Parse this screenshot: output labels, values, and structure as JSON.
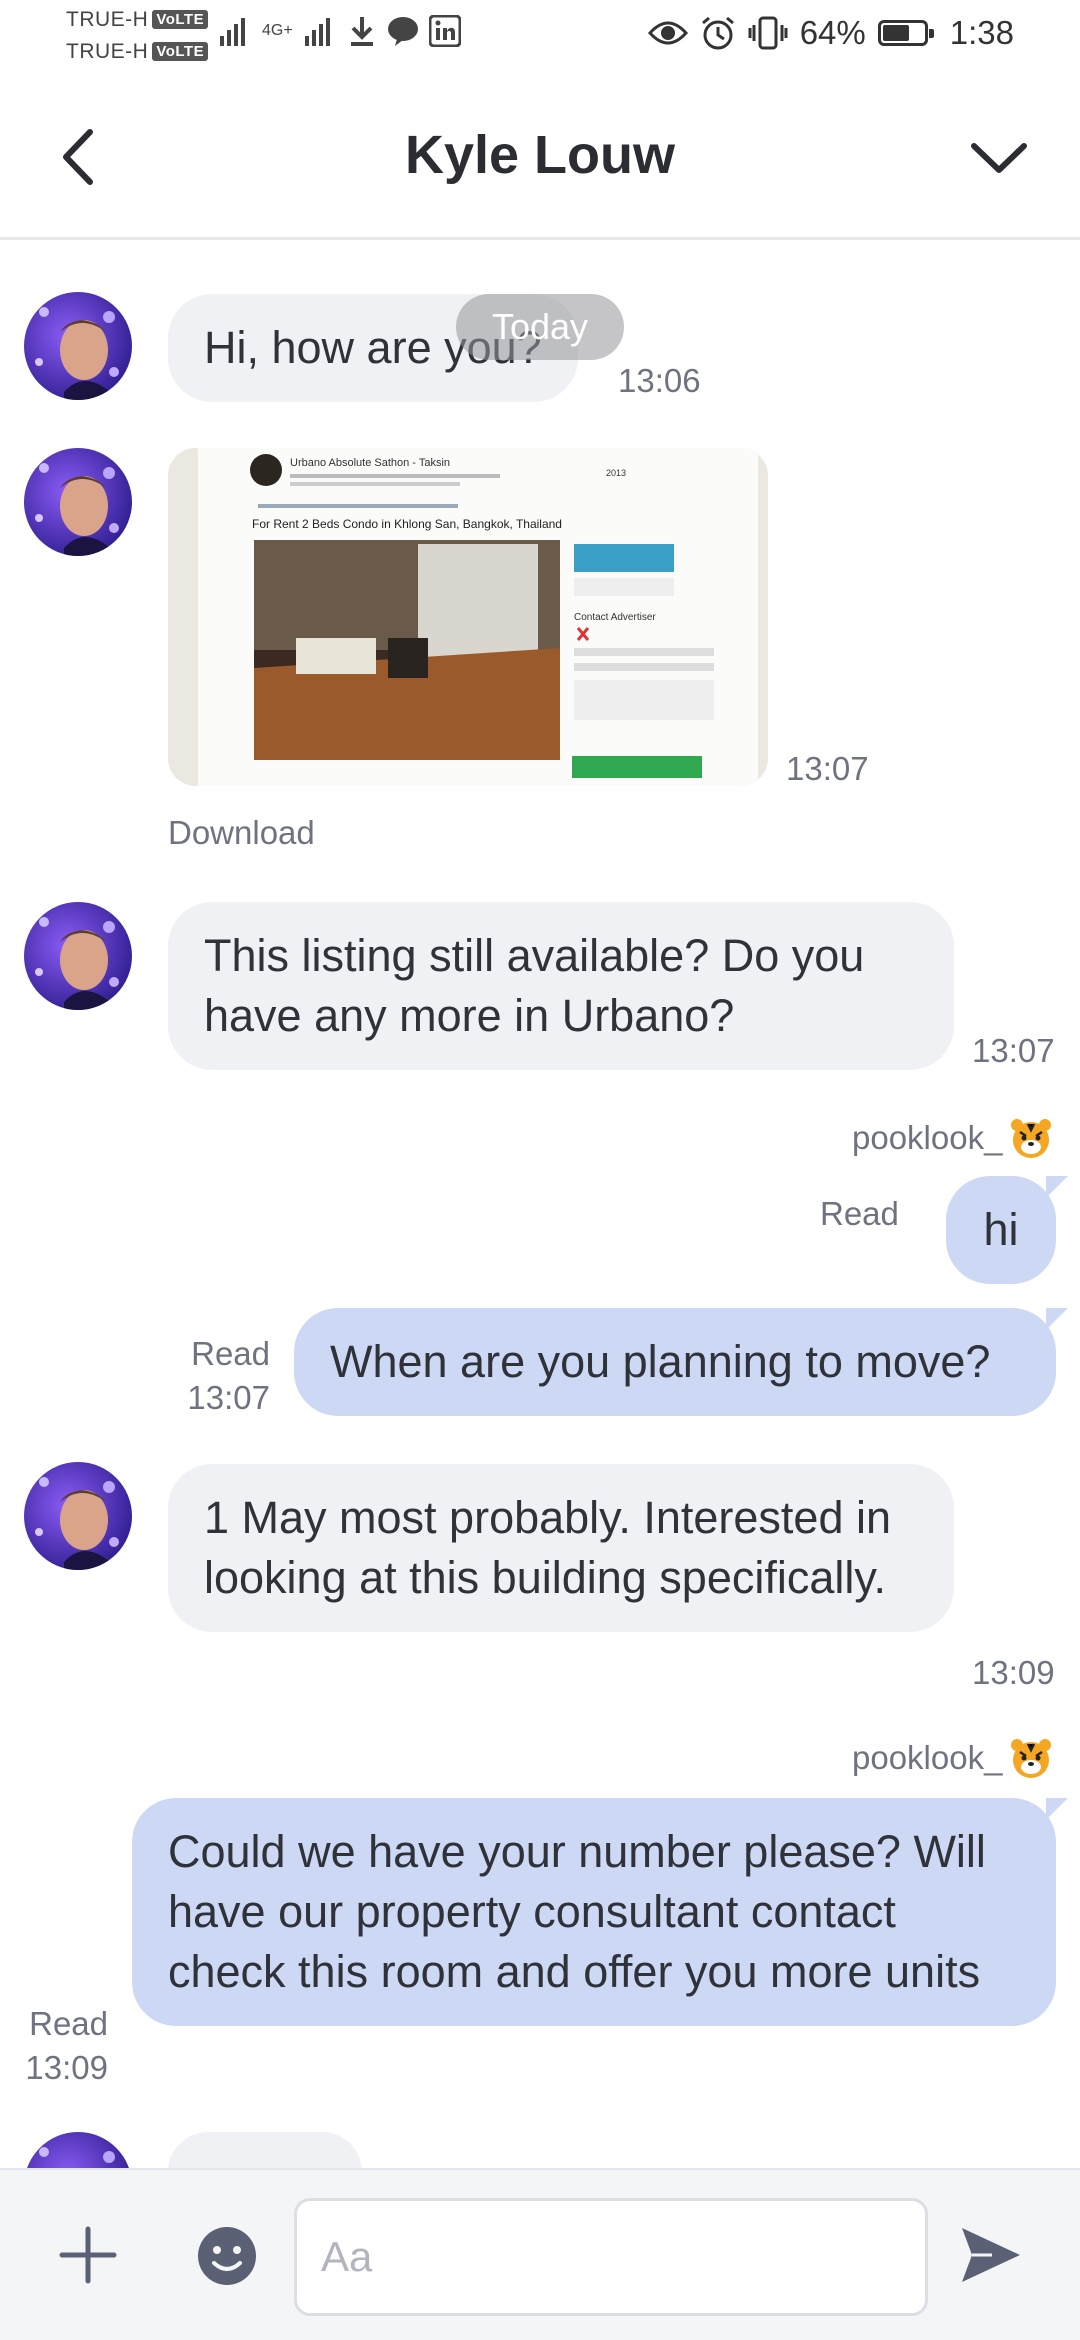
{
  "status_bar": {
    "carrier1": "TRUE-H",
    "carrier2": "TRUE-H",
    "volte": "VoLTE",
    "network": "4G+",
    "battery": "64%",
    "battery_level": 0.64,
    "time": "1:38"
  },
  "header": {
    "title": "Kyle Louw"
  },
  "chat": {
    "date_separator": "Today",
    "messages": [
      {
        "text": "Hi, how are you?",
        "time": "13:06"
      },
      {
        "type": "image",
        "time": "13:07",
        "download_label": "Download",
        "image_text": {
          "building": "Urbano Absolute Sathon - Taksin",
          "listing": "For Rent 2 Beds Condo in Khlong San, Bangkok, Thailand",
          "year": "2013",
          "contact": "Contact Advertiser"
        }
      },
      {
        "text": "This listing still available? Do you have any more in Urbano?",
        "time": "13:07"
      },
      {
        "sender": "pooklook_",
        "text": "hi",
        "status": "Read"
      },
      {
        "text": "When are you planning to move?",
        "status": "Read",
        "time": "13:07"
      },
      {
        "text": "1 May most probably. Interested in looking at this building specifically.",
        "time": "13:09"
      },
      {
        "sender": "pooklook_",
        "text": "Could we have your number please? Will have our property consultant contact check this room and offer you more units",
        "status": "Read",
        "time": "13:09"
      }
    ]
  },
  "input_bar": {
    "placeholder": "Aa"
  },
  "colors": {
    "incoming_bubble": "#f0f1f4",
    "outgoing_bubble": "#cdd9f4",
    "icon": "#5b6175"
  }
}
